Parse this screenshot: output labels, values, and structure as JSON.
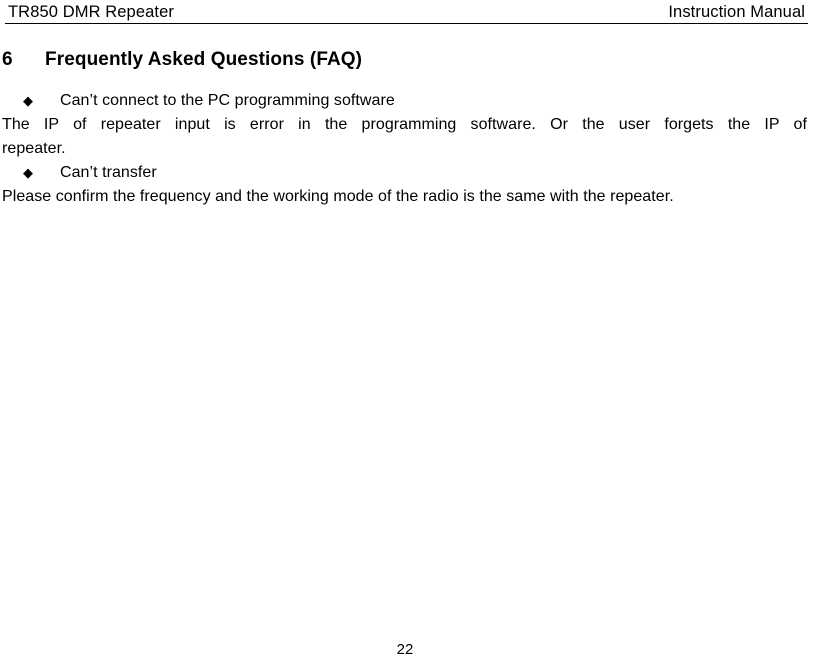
{
  "document": {
    "header": {
      "left_text": "TR850 DMR Repeater",
      "right_text": "Instruction Manual"
    },
    "section": {
      "number": "6",
      "title": "Frequently Asked Questions (FAQ)"
    },
    "blocks": [
      {
        "type": "bullet",
        "marker": "◆",
        "text": "Can’t connect to the PC programming software"
      },
      {
        "type": "paragraph",
        "line_1": "The IP of repeater input is error in the programming software. Or the user forgets the IP of",
        "line_2": "repeater."
      },
      {
        "type": "bullet",
        "marker": "◆",
        "text": "Can’t transfer"
      },
      {
        "type": "paragraph",
        "line_1": "Please confirm the frequency and the working mode of the radio is the same with the repeater."
      }
    ],
    "footer": {
      "page_number": "22"
    }
  }
}
